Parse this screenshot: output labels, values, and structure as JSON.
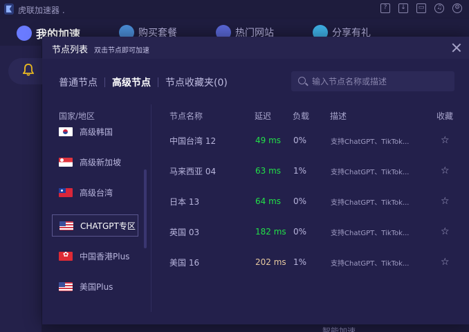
{
  "app": {
    "title": "虎联加速器 ."
  },
  "nav": {
    "items": [
      {
        "label": "我的加速",
        "color": "#6a7bff"
      },
      {
        "label": "购买套餐",
        "color": "#4b8ed8"
      },
      {
        "label": "热门网站",
        "color": "#5a68d8"
      },
      {
        "label": "分享有礼",
        "color": "#3fb2e8"
      }
    ]
  },
  "titlebar_icons": [
    "help-icon",
    "download-icon",
    "folder-icon",
    "headset-icon",
    "settings-icon"
  ],
  "bottom_text": "智能加速",
  "modal": {
    "title": "节点列表",
    "subtitle": "双击节点即可加速",
    "tabs": [
      "普通节点",
      "高级节点",
      "节点收藏夹(0)"
    ],
    "active_tab": 1,
    "search_placeholder": "输入节点名称或描述",
    "region_header": "国家/地区",
    "regions": [
      {
        "name": "高级韩国",
        "flag": "kr"
      },
      {
        "name": "高级新加坡",
        "flag": "sg"
      },
      {
        "name": "高级台湾",
        "flag": "tw"
      },
      {
        "name": "CHATGPT专区",
        "flag": "us",
        "selected": true
      },
      {
        "name": "中国香港Plus",
        "flag": "hk"
      },
      {
        "name": "美国Plus",
        "flag": "us"
      }
    ],
    "columns": [
      "节点名称",
      "延迟",
      "负载",
      "描述",
      "收藏"
    ],
    "nodes": [
      {
        "name": "中国台湾 12",
        "latency": "49 ms",
        "load": "0%",
        "desc": "支持ChatGPT、TikTok..."
      },
      {
        "name": "马来西亚 04",
        "latency": "63 ms",
        "load": "1%",
        "desc": "支持ChatGPT、TikTok..."
      },
      {
        "name": "日本 13",
        "latency": "64 ms",
        "load": "0%",
        "desc": "支持ChatGPT、TikTok..."
      },
      {
        "name": "英国 03",
        "latency": "182 ms",
        "load": "0%",
        "desc": "支持ChatGPT、TikTok..."
      },
      {
        "name": "美国 16",
        "latency": "202 ms",
        "load": "1%",
        "desc": "支持ChatGPT、TikTok..."
      }
    ],
    "colors": {
      "latency_good": "#22e048",
      "latency_slow": "#e6c9a0",
      "accent": "#f2c021"
    }
  }
}
